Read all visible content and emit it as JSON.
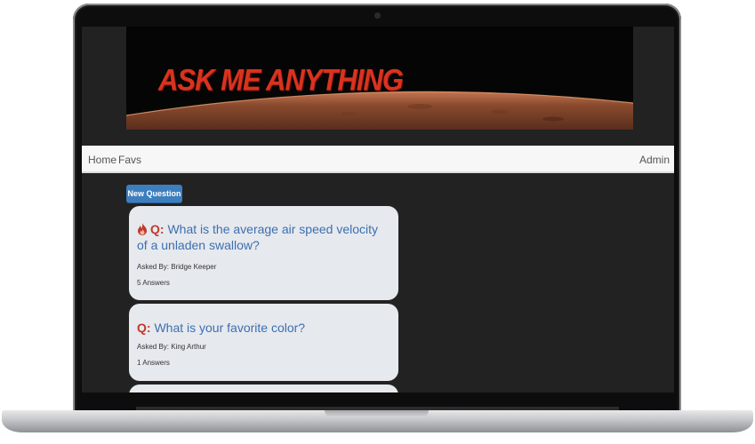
{
  "banner": {
    "title": "ASK ME ANYTHING"
  },
  "nav": {
    "home": "Home",
    "favs": "Favs",
    "admin": "Admin"
  },
  "actions": {
    "new_question": "New Question"
  },
  "questions": [
    {
      "prefix": "Q:",
      "text": "What is the average air speed velocity of a unladen swallow?",
      "hot": true,
      "asked_by": "Asked By: Bridge Keeper",
      "answers": "5 Answers"
    },
    {
      "prefix": "Q:",
      "text": "What is your favorite color?",
      "hot": false,
      "asked_by": "Asked By: King Arthur",
      "answers": "1 Answers"
    }
  ],
  "colors": {
    "accent": "#3d7ebf",
    "question_prefix": "#c0392b",
    "question_text": "#3d6fb0",
    "banner_title": "#d9331f"
  }
}
